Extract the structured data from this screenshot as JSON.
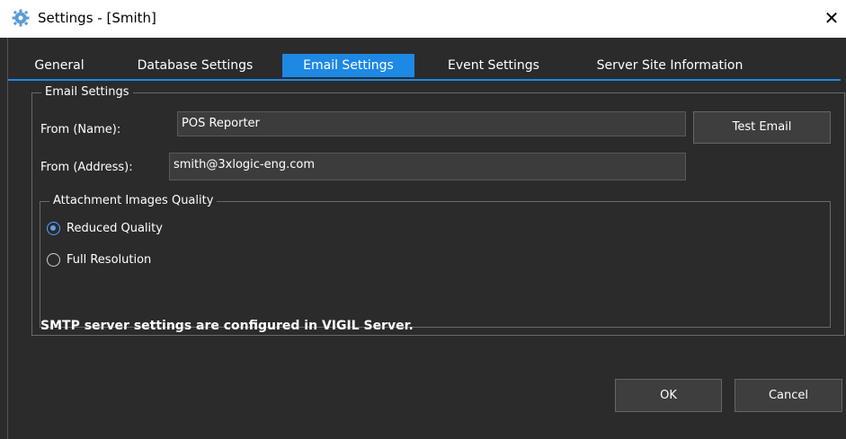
{
  "window": {
    "title": "Settings - [Smith]",
    "close_label": "✕"
  },
  "tabs": [
    {
      "label": "General"
    },
    {
      "label": "Database Settings"
    },
    {
      "label": "Email Settings",
      "active": true
    },
    {
      "label": "Event Settings"
    },
    {
      "label": "Server Site Information"
    }
  ],
  "email_settings": {
    "group_title": "Email Settings",
    "from_name_label": "From (Name):",
    "from_name_value": "POS Reporter",
    "test_email_label": "Test Email",
    "from_address_label": "From (Address):",
    "from_address_value": "smith@3xlogic-eng.com",
    "attachment_group_title": "Attachment Images Quality",
    "options": [
      {
        "label": "Reduced Quality",
        "selected": true
      },
      {
        "label": "Full Resolution",
        "selected": false
      }
    ],
    "note": "SMTP server settings are configured in VIGIL Server."
  },
  "footer": {
    "ok_label": "OK",
    "cancel_label": "Cancel"
  },
  "colors": {
    "background": "#2b2b2b",
    "accent": "#1e88e5"
  }
}
